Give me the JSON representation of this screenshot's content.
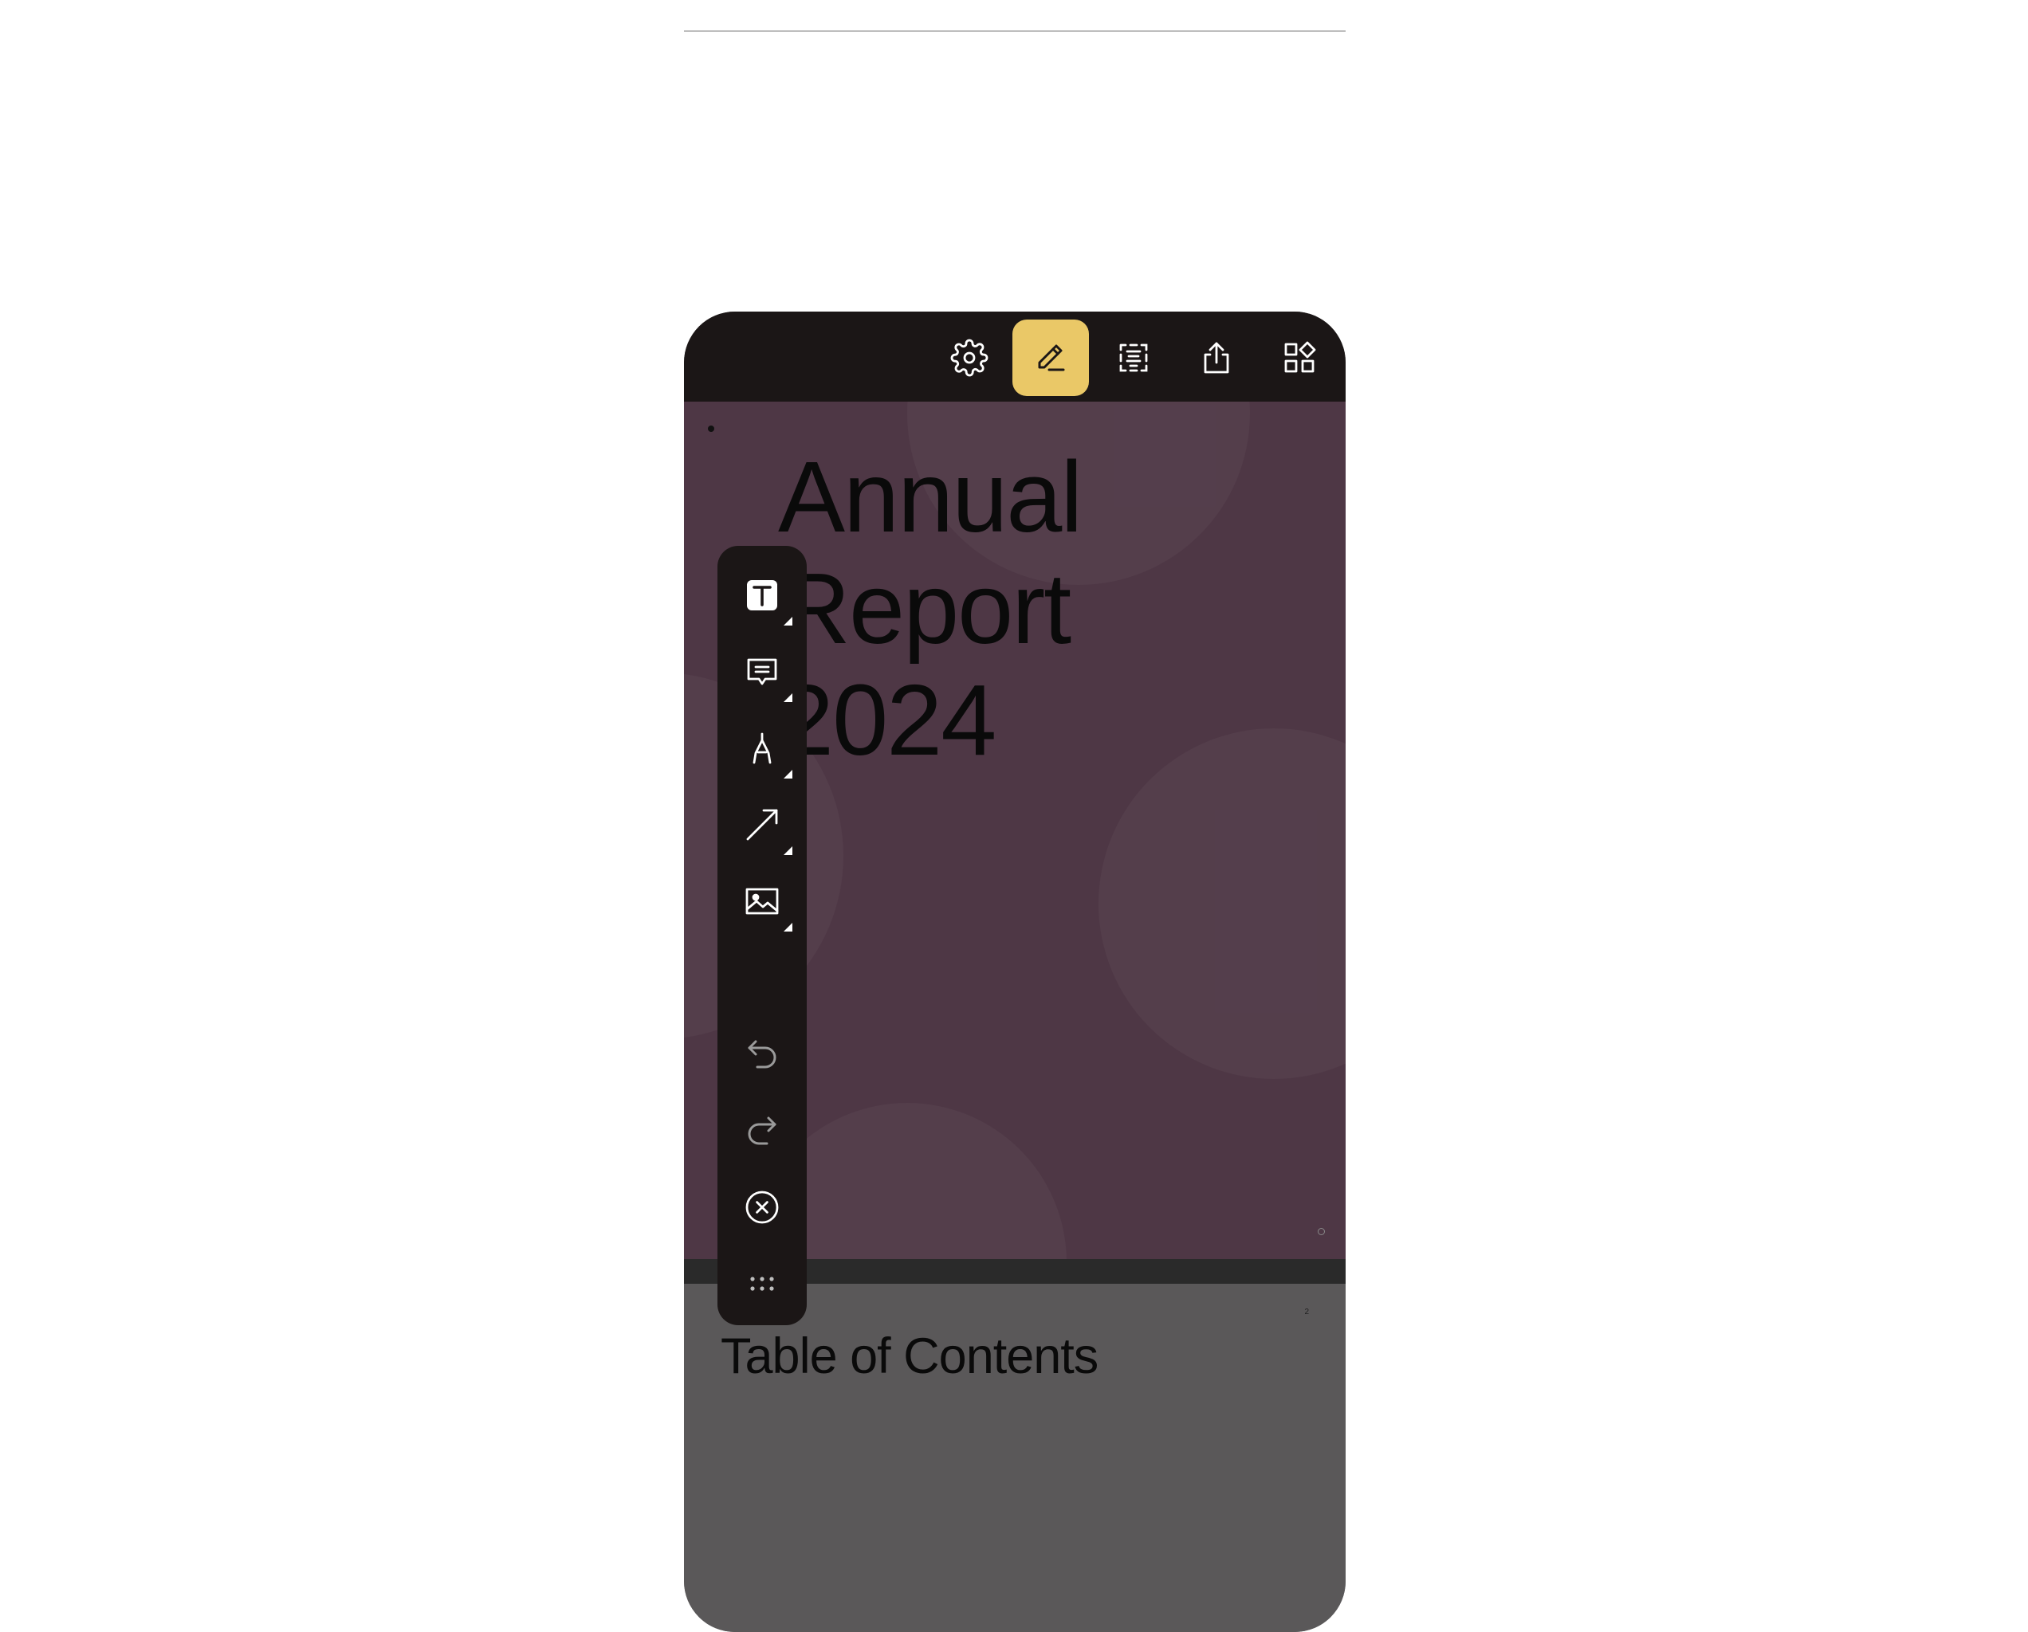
{
  "toolbar": {
    "buttons": [
      {
        "name": "settings",
        "icon": "gear-icon",
        "active": false
      },
      {
        "name": "annotate",
        "icon": "pencil-icon",
        "active": true
      },
      {
        "name": "text-selection",
        "icon": "text-selection-icon",
        "active": false
      },
      {
        "name": "share",
        "icon": "share-icon",
        "active": false
      },
      {
        "name": "thumbnails",
        "icon": "grid-shapes-icon",
        "active": false
      }
    ],
    "accent_color": "#eac867"
  },
  "document": {
    "cover": {
      "title_line1": "Annual",
      "title_line2": "Report",
      "title_line3": "2024",
      "background_color": "#4e3745"
    },
    "page2": {
      "page_number": "2",
      "heading": "Table of Contents",
      "background_color": "#5a5859"
    }
  },
  "annotation_toolbar": {
    "tools": [
      {
        "name": "text",
        "icon": "text-box-icon",
        "has_submenu": true
      },
      {
        "name": "note",
        "icon": "comment-icon",
        "has_submenu": true
      },
      {
        "name": "ink",
        "icon": "pen-nib-icon",
        "has_submenu": true
      },
      {
        "name": "line",
        "icon": "arrow-line-icon",
        "has_submenu": true
      },
      {
        "name": "image",
        "icon": "image-icon",
        "has_submenu": true
      }
    ],
    "actions": [
      {
        "name": "undo",
        "icon": "undo-icon"
      },
      {
        "name": "redo",
        "icon": "redo-icon"
      },
      {
        "name": "close",
        "icon": "close-circle-icon"
      },
      {
        "name": "drag-handle",
        "icon": "drag-dots-icon"
      }
    ]
  }
}
